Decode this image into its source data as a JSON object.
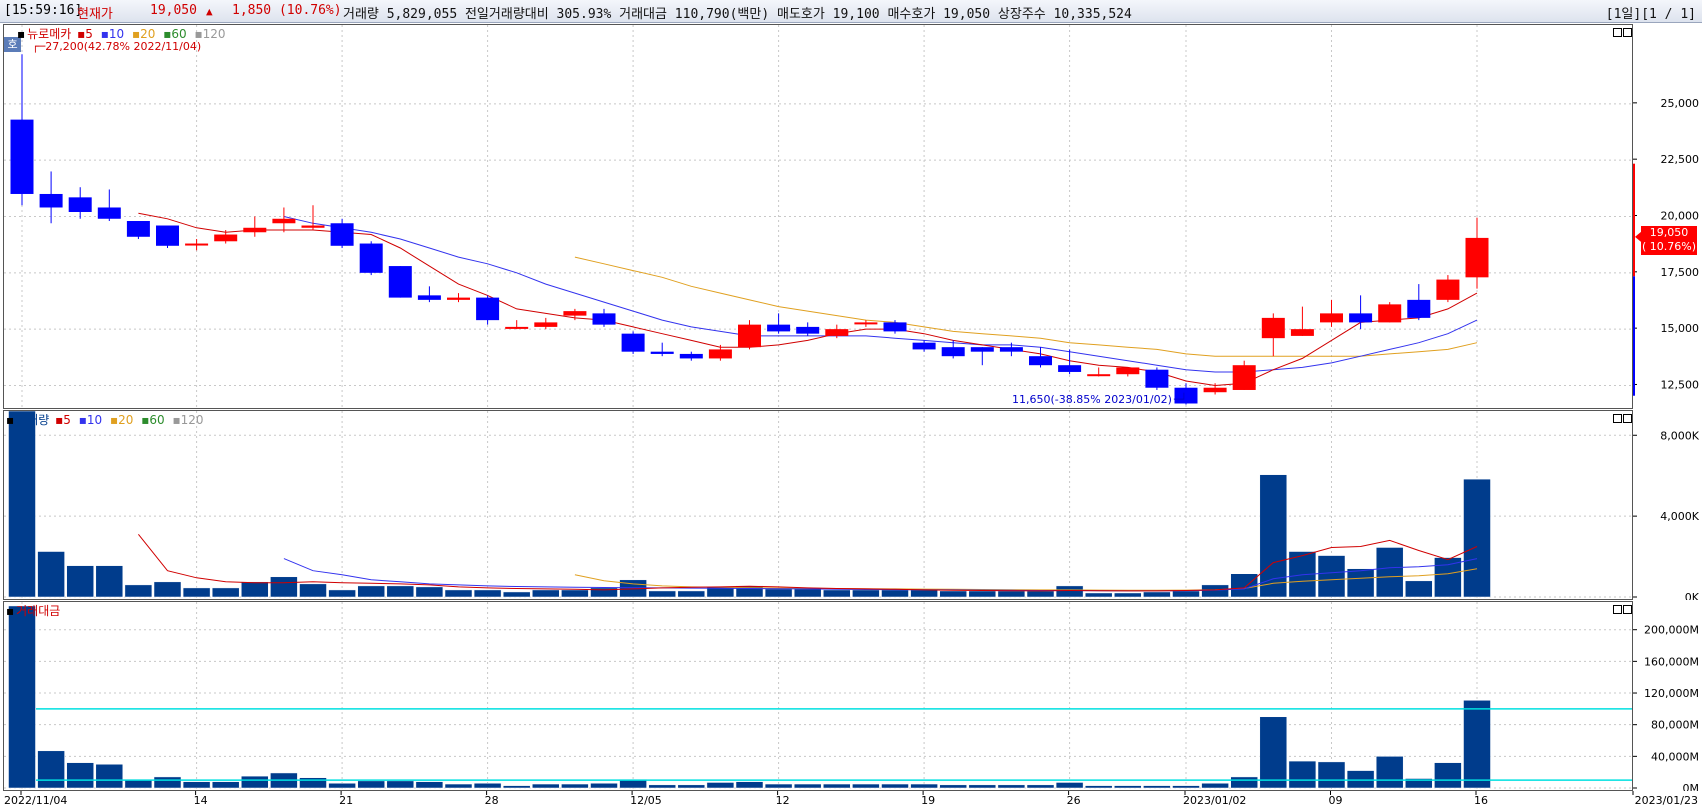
{
  "header": {
    "time": "[15:59:16]",
    "current_label": "현재가",
    "price": "19,050",
    "change_arrow": "▲",
    "change": "1,850 (10.76%)",
    "info": "거래량 5,829,055  전일거래량대비 305.93%  거래대금 110,790(백만)  매도호가 19,100  매수호가 19,050  상장주수 10,335,524",
    "page": "[1일][1 / 1]"
  },
  "badge": "호",
  "price_legend": {
    "name": "뉴로메카",
    "ma": [
      "5",
      "10",
      "20",
      "60",
      "120"
    ]
  },
  "volume_legend": {
    "name": "거래량",
    "ma": [
      "5",
      "10",
      "20",
      "60",
      "120"
    ]
  },
  "amount_legend": {
    "name": "거래대금"
  },
  "high_annotation": "27,200(42.78% 2022/11/04)",
  "low_annotation": "11,650(-38.85% 2023/01/02)",
  "price_tag": {
    "price": "19,050",
    "pct": "( 10.76%)"
  },
  "colors": {
    "up": "#ff0000",
    "down": "#0000ff",
    "bar": "#003c8c",
    "ma5": "#d00000",
    "ma10": "#3333ee",
    "ma20": "#e0a020",
    "ma60": "#2c8c2c",
    "ma120": "#999999",
    "threshold": "#00e0e0"
  },
  "chart_data": {
    "type": "candlestick",
    "dates": [
      "2022/11/04",
      "11/07",
      "11/08",
      "11/09",
      "11/10",
      "11/11",
      "11/14",
      "11/15",
      "11/16",
      "11/17",
      "11/18",
      "11/21",
      "11/22",
      "11/23",
      "11/24",
      "11/25",
      "11/28",
      "11/29",
      "11/30",
      "12/01",
      "12/02",
      "12/05",
      "12/06",
      "12/07",
      "12/08",
      "12/09",
      "12/12",
      "12/13",
      "12/14",
      "12/15",
      "12/16",
      "12/19",
      "12/20",
      "12/21",
      "12/22",
      "12/23",
      "12/26",
      "12/27",
      "12/28",
      "12/29",
      "2023/01/02",
      "01/03",
      "01/04",
      "01/05",
      "01/06",
      "01/09",
      "01/10",
      "01/11",
      "01/12",
      "01/13",
      "01/16"
    ],
    "x_tick_labels": [
      {
        "i": 0,
        "label": "2022/11/04"
      },
      {
        "i": 6,
        "label": "14"
      },
      {
        "i": 11,
        "label": "21"
      },
      {
        "i": 16,
        "label": "28"
      },
      {
        "i": 21,
        "label": "12/05"
      },
      {
        "i": 26,
        "label": "12"
      },
      {
        "i": 31,
        "label": "19"
      },
      {
        "i": 36,
        "label": "26"
      },
      {
        "i": 40,
        "label": "2023/01/02"
      },
      {
        "i": 45,
        "label": "09"
      },
      {
        "i": 50,
        "label": "16"
      }
    ],
    "x_end_label": "2023/01/23",
    "price": {
      "ylim": [
        11500,
        28500
      ],
      "yticks": [
        "12,500",
        "15,000",
        "17,500",
        "20,000",
        "22,500",
        "25,000"
      ],
      "ytick_values": [
        12500,
        15000,
        17500,
        20000,
        22500,
        25000
      ],
      "open": [
        24300,
        21000,
        20850,
        20400,
        19800,
        19600,
        18800,
        18900,
        19300,
        19700,
        19500,
        19700,
        18800,
        17800,
        16500,
        16300,
        16400,
        15100,
        15100,
        15600,
        15700,
        14800,
        14000,
        13900,
        13700,
        14200,
        15200,
        15100,
        14700,
        15300,
        15300,
        14400,
        14200,
        14200,
        14200,
        13800,
        13400,
        13000,
        13000,
        13200,
        12400,
        12200,
        12300,
        14600,
        14700,
        15300,
        15700,
        15300,
        16300,
        16300,
        17300
      ],
      "close": [
        21000,
        20400,
        20200,
        19900,
        19100,
        18700,
        18800,
        19200,
        19500,
        19900,
        19600,
        18700,
        17500,
        16400,
        16300,
        16400,
        15400,
        15100,
        15300,
        15800,
        15200,
        14000,
        13900,
        13700,
        14100,
        15200,
        14900,
        14800,
        15000,
        15300,
        14900,
        14100,
        13800,
        14000,
        14000,
        13400,
        13100,
        13000,
        13300,
        12400,
        11700,
        12400,
        13400,
        15500,
        15000,
        15700,
        15300,
        16100,
        15500,
        17200,
        19050
      ],
      "high": [
        27200,
        22000,
        21300,
        21200,
        19800,
        19500,
        19000,
        19400,
        20000,
        20400,
        20500,
        19900,
        18900,
        17800,
        16900,
        16600,
        16500,
        15400,
        15500,
        15900,
        15900,
        14900,
        14400,
        14000,
        14300,
        15400,
        15700,
        15300,
        15200,
        15400,
        15400,
        14500,
        14500,
        14200,
        14400,
        14200,
        14100,
        13300,
        13300,
        13300,
        12600,
        12600,
        13600,
        15700,
        16000,
        16300,
        16500,
        16200,
        17000,
        17400,
        19950
      ],
      "low": [
        20500,
        19700,
        19900,
        19800,
        19000,
        18600,
        18500,
        18800,
        19100,
        19300,
        19400,
        18600,
        17400,
        16400,
        16200,
        16200,
        15200,
        15000,
        15000,
        15400,
        15100,
        13900,
        13800,
        13600,
        13600,
        14100,
        14800,
        14700,
        14600,
        15100,
        14800,
        14000,
        13700,
        13400,
        13800,
        13300,
        13000,
        12900,
        12900,
        12300,
        11650,
        12100,
        12300,
        13800,
        14700,
        15100,
        15000,
        15300,
        15400,
        16200,
        16800
      ],
      "ma5": [
        null,
        null,
        null,
        null,
        20140,
        19900,
        19500,
        19300,
        19400,
        19400,
        19400,
        19300,
        19200,
        18600,
        17800,
        17000,
        16500,
        15900,
        15700,
        15500,
        15400,
        15100,
        14800,
        14500,
        14200,
        14200,
        14300,
        14500,
        14800,
        15000,
        15000,
        14800,
        14500,
        14300,
        14100,
        13900,
        13600,
        13400,
        13300,
        13100,
        12700,
        12500,
        12600,
        13200,
        13700,
        14500,
        15300,
        15400,
        15500,
        15900,
        16600
      ],
      "ma10": [
        null,
        null,
        null,
        null,
        null,
        null,
        null,
        null,
        null,
        20000,
        19700,
        19500,
        19300,
        19000,
        18600,
        18200,
        17900,
        17500,
        17000,
        16600,
        16200,
        15800,
        15400,
        15100,
        14900,
        14700,
        14700,
        14700,
        14700,
        14700,
        14600,
        14500,
        14400,
        14300,
        14300,
        14200,
        14000,
        13800,
        13600,
        13400,
        13200,
        13100,
        13100,
        13200,
        13300,
        13500,
        13800,
        14100,
        14400,
        14800,
        15400
      ],
      "ma20": [
        null,
        null,
        null,
        null,
        null,
        null,
        null,
        null,
        null,
        null,
        null,
        null,
        null,
        null,
        null,
        null,
        null,
        null,
        null,
        18200,
        17900,
        17600,
        17300,
        16900,
        16600,
        16300,
        16000,
        15800,
        15600,
        15400,
        15300,
        15100,
        14900,
        14800,
        14700,
        14600,
        14400,
        14300,
        14200,
        14100,
        13900,
        13800,
        13800,
        13800,
        13800,
        13800,
        13800,
        13900,
        14000,
        14100,
        14400
      ]
    },
    "volume": {
      "ylim": [
        0,
        9200
      ],
      "unit": "K",
      "yticks": [
        "0K",
        "4,000K",
        "8,000K"
      ],
      "ytick_values": [
        0,
        4000,
        8000
      ],
      "values": [
        9200,
        2250,
        1550,
        1550,
        600,
        750,
        450,
        450,
        750,
        1000,
        650,
        350,
        550,
        550,
        500,
        350,
        350,
        250,
        350,
        350,
        450,
        850,
        300,
        300,
        500,
        550,
        400,
        400,
        350,
        350,
        350,
        350,
        300,
        300,
        300,
        300,
        550,
        200,
        200,
        250,
        300,
        600,
        1150,
        6050,
        2250,
        2050,
        1400,
        2450,
        800,
        1950,
        5830
      ],
      "ma5": [
        null,
        null,
        null,
        null,
        3100,
        1300,
        950,
        750,
        700,
        700,
        750,
        700,
        680,
        650,
        600,
        500,
        450,
        420,
        400,
        380,
        350,
        400,
        450,
        480,
        500,
        530,
        500,
        450,
        420,
        400,
        380,
        350,
        330,
        320,
        310,
        300,
        320,
        310,
        300,
        300,
        320,
        350,
        450,
        1700,
        2050,
        2450,
        2500,
        2800,
        2300,
        1850,
        2500
      ],
      "ma10": [
        null,
        null,
        null,
        null,
        null,
        null,
        null,
        null,
        null,
        1900,
        1300,
        1100,
        850,
        750,
        650,
        600,
        550,
        520,
        500,
        480,
        470,
        460,
        450,
        440,
        430,
        420,
        410,
        400,
        380,
        370,
        360,
        360,
        350,
        340,
        330,
        320,
        320,
        310,
        300,
        300,
        310,
        340,
        400,
        900,
        1100,
        1200,
        1300,
        1450,
        1500,
        1600,
        1900
      ],
      "ma20": [
        null,
        null,
        null,
        null,
        null,
        null,
        null,
        null,
        null,
        null,
        null,
        null,
        null,
        null,
        null,
        null,
        null,
        null,
        null,
        1100,
        800,
        650,
        550,
        500,
        480,
        460,
        440,
        430,
        420,
        410,
        400,
        390,
        380,
        370,
        360,
        350,
        350,
        340,
        330,
        330,
        340,
        360,
        420,
        680,
        780,
        850,
        930,
        1000,
        1050,
        1150,
        1400
      ]
    },
    "amount": {
      "ylim": [
        0,
        235000
      ],
      "unit": "M",
      "yticks": [
        "0M",
        "40,000M",
        "80,000M",
        "120,000M",
        "160,000M",
        "200,000M"
      ],
      "ytick_values": [
        0,
        40000,
        80000,
        120000,
        160000,
        200000
      ],
      "thresholds": [
        100000,
        10000
      ],
      "values": [
        230000,
        47000,
        32000,
        30000,
        11000,
        14000,
        8000,
        8000,
        15000,
        19000,
        13000,
        6000,
        9000,
        9000,
        8000,
        5000,
        6000,
        3000,
        5000,
        5000,
        6000,
        11000,
        4000,
        4000,
        7000,
        8000,
        5000,
        5000,
        5000,
        5000,
        5000,
        5000,
        4000,
        4000,
        4000,
        4000,
        7000,
        3000,
        3000,
        3000,
        3000,
        6000,
        14000,
        90000,
        34000,
        33000,
        22000,
        40000,
        12000,
        32000,
        110790
      ]
    }
  }
}
